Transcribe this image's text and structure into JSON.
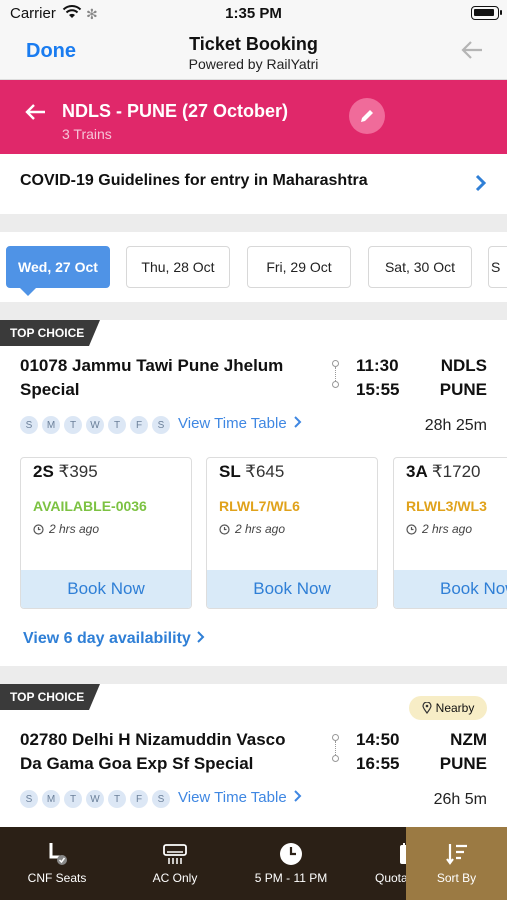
{
  "status_bar": {
    "carrier": "Carrier",
    "time": "1:35 PM"
  },
  "nav": {
    "done": "Done",
    "title": "Ticket Booking",
    "subtitle": "Powered by RailYatri"
  },
  "route": {
    "title": "NDLS - PUNE (27 October)",
    "subtitle": "3 Trains"
  },
  "covid": {
    "text": "COVID-19 Guidelines for entry in Maharashtra"
  },
  "dates": [
    {
      "label": "Wed, 27 Oct",
      "selected": true
    },
    {
      "label": "Thu, 28 Oct",
      "selected": false
    },
    {
      "label": "Fri, 29 Oct",
      "selected": false
    },
    {
      "label": "Sat, 30 Oct",
      "selected": false
    },
    {
      "label": "S",
      "selected": false
    }
  ],
  "train1": {
    "badge": "TOP CHOICE",
    "name": "01078 Jammu Tawi Pune Jhelum Special",
    "dep_time": "11:30",
    "arr_time": "15:55",
    "from": "NDLS",
    "to": "PUNE",
    "days": [
      "S",
      "M",
      "T",
      "W",
      "T",
      "F",
      "S"
    ],
    "timetable": "View Time Table",
    "duration": "28h 25m",
    "classes": [
      {
        "name": "2S",
        "price": "₹395",
        "availability": "AVAILABLE-0036",
        "status_color": "#7cc242",
        "updated": "2 hrs ago",
        "action": "Book Now"
      },
      {
        "name": "SL",
        "price": "₹645",
        "availability": "RLWL7/WL6",
        "status_color": "#e0a21b",
        "updated": "2 hrs ago",
        "action": "Book Now"
      },
      {
        "name": "3A",
        "price": "₹1720",
        "availability": "RLWL3/WL3",
        "status_color": "#e0a21b",
        "updated": "2 hrs ago",
        "action": "Book Now"
      }
    ],
    "availability_link": "View 6 day availability"
  },
  "train2": {
    "badge": "TOP CHOICE",
    "nearby": "Nearby",
    "name": "02780 Delhi H Nizamuddin Vasco Da Gama Goa Exp Sf Special",
    "dep_time": "14:50",
    "arr_time": "16:55",
    "from": "NZM",
    "to": "PUNE",
    "days": [
      "S",
      "M",
      "T",
      "W",
      "T",
      "F",
      "S"
    ],
    "timetable": "View Time Table",
    "duration": "26h 5m"
  },
  "tabbar": [
    {
      "label": "CNF Seats",
      "icon": "seat-icon"
    },
    {
      "label": "AC Only",
      "icon": "ac-icon"
    },
    {
      "label": "5 PM - 11 PM",
      "icon": "clock-icon"
    },
    {
      "label": "Quota",
      "icon": "quota-icon"
    },
    {
      "label": "Sort By",
      "icon": "sort-icon"
    }
  ],
  "colors": {
    "primary": "#e0286a",
    "link": "#2f7fd6",
    "tabbar": "#2b2016",
    "tab_active": "#9b7a43"
  }
}
